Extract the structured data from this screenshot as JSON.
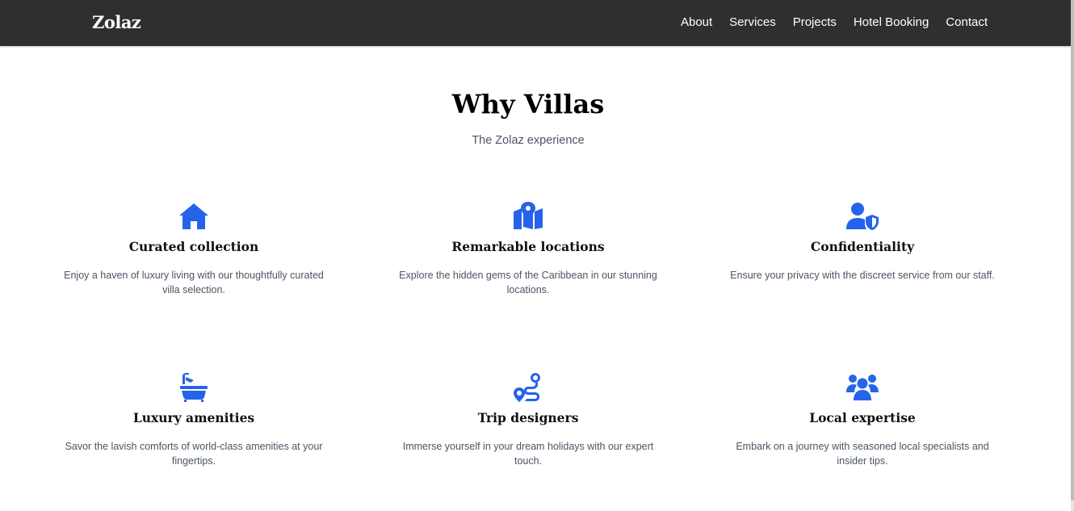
{
  "nav": {
    "brand": "Zolaz",
    "links": [
      "About",
      "Services",
      "Projects",
      "Hotel Booking",
      "Contact"
    ]
  },
  "hero": {
    "title": "Why Villas",
    "subtitle": "The Zolaz experience"
  },
  "features": [
    {
      "icon": "house-icon",
      "title": "Curated collection",
      "text": "Enjoy a haven of luxury living with our thoughtfully curated villa selection."
    },
    {
      "icon": "map-location-icon",
      "title": "Remarkable locations",
      "text": "Explore the hidden gems of the Caribbean in our stunning locations."
    },
    {
      "icon": "user-shield-icon",
      "title": "Confidentiality",
      "text": "Ensure your privacy with the discreet service from our staff."
    },
    {
      "icon": "bath-icon",
      "title": "Luxury amenities",
      "text": "Savor the lavish comforts of world-class amenities at your fingertips."
    },
    {
      "icon": "route-icon",
      "title": "Trip designers",
      "text": "Immerse yourself in your dream holidays with our expert touch."
    },
    {
      "icon": "users-icon",
      "title": "Local expertise",
      "text": "Embark on a journey with seasoned local specialists and insider tips."
    }
  ],
  "colors": {
    "navbar": "#2f2f2f",
    "accent": "#2563eb",
    "body_text": "#4b5563"
  }
}
